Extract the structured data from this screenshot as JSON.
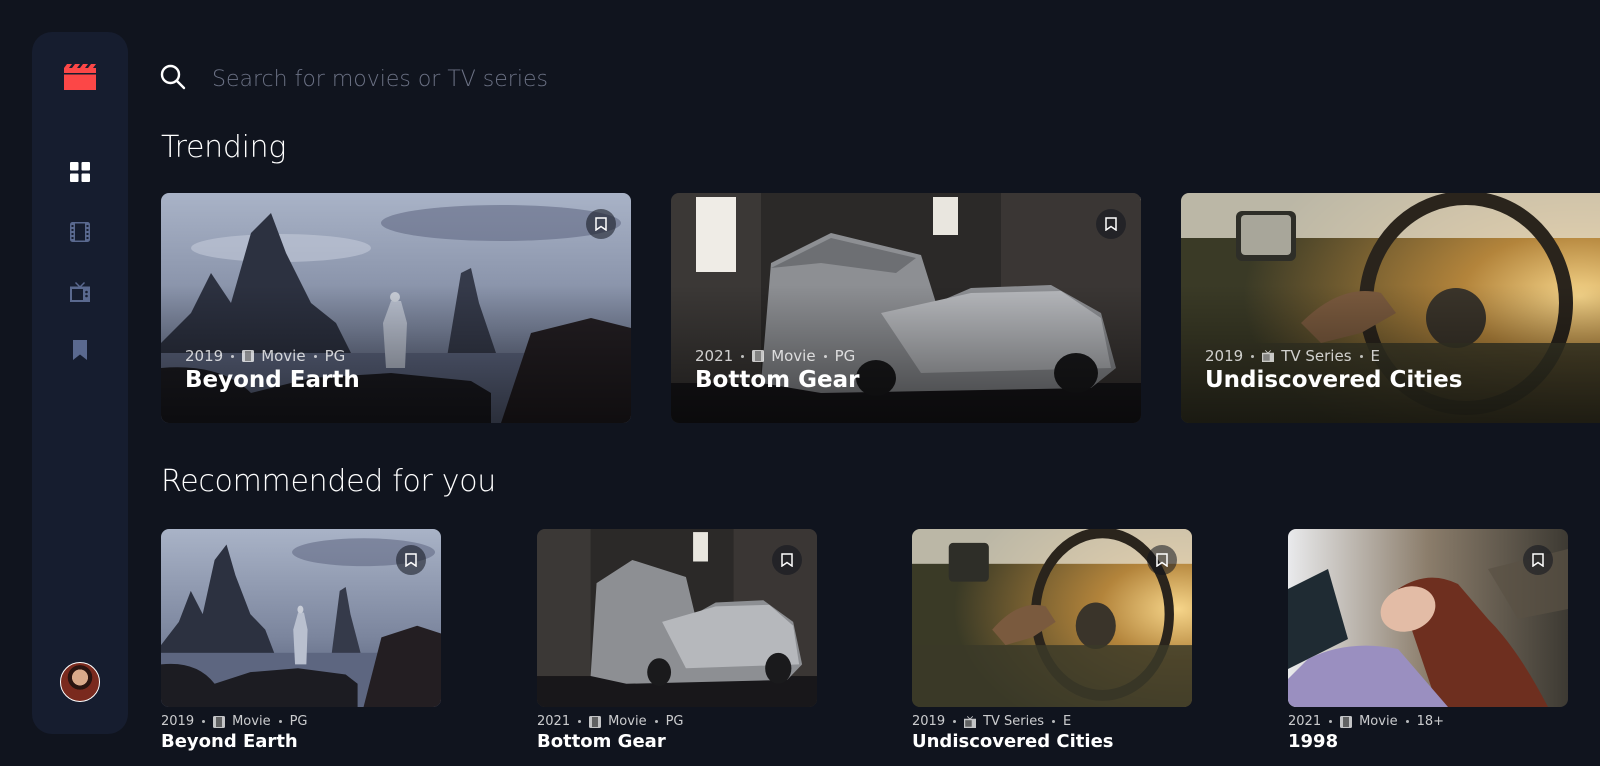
{
  "search": {
    "placeholder": "Search for movies or TV series"
  },
  "nav": [
    "home",
    "movies",
    "tv-series",
    "bookmarks"
  ],
  "colors": {
    "background": "#10141e",
    "sidebar": "#161d2f",
    "accent": "#fc4747",
    "nav_inactive": "#5a698f"
  },
  "trending": {
    "title": "Trending",
    "items": [
      {
        "year": "2019",
        "category": "Movie",
        "rating": "PG",
        "title": "Beyond Earth"
      },
      {
        "year": "2021",
        "category": "Movie",
        "rating": "PG",
        "title": "Bottom Gear"
      },
      {
        "year": "2019",
        "category": "TV Series",
        "rating": "E",
        "title": "Undiscovered Cities"
      }
    ]
  },
  "recommended": {
    "title": "Recommended for you",
    "items": [
      {
        "year": "2019",
        "category": "Movie",
        "rating": "PG",
        "title": "Beyond Earth"
      },
      {
        "year": "2021",
        "category": "Movie",
        "rating": "PG",
        "title": "Bottom Gear"
      },
      {
        "year": "2019",
        "category": "TV Series",
        "rating": "E",
        "title": "Undiscovered Cities"
      },
      {
        "year": "2021",
        "category": "Movie",
        "rating": "18+",
        "title": "1998"
      }
    ]
  }
}
